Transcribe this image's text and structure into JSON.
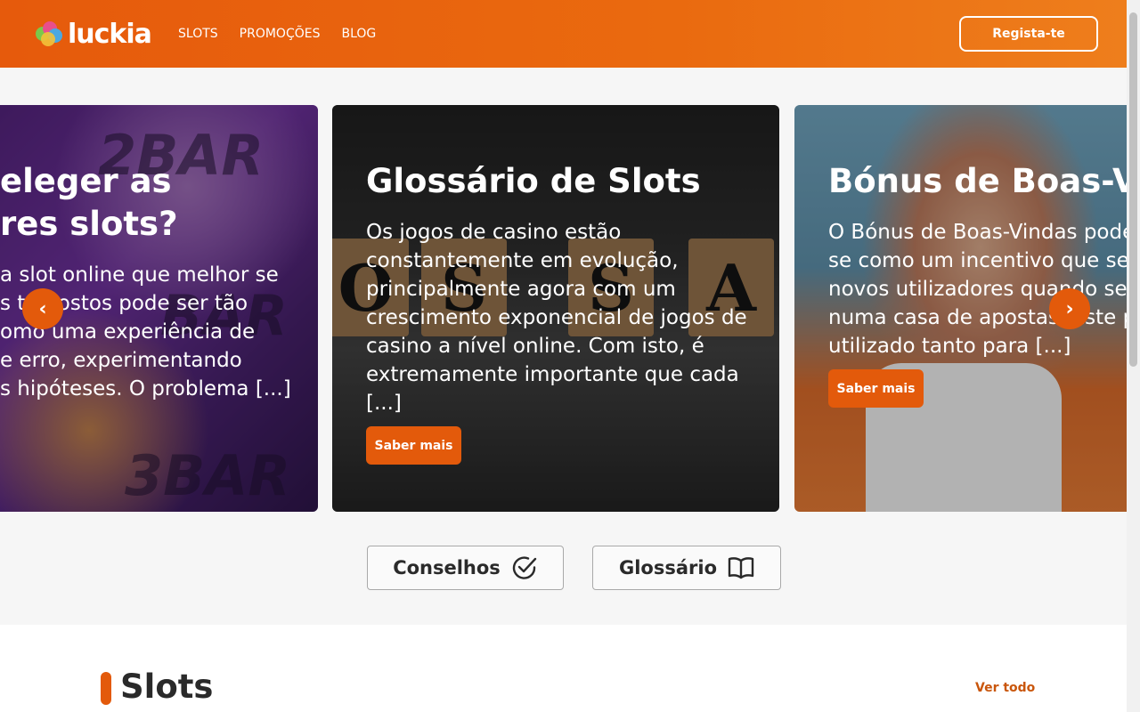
{
  "header": {
    "logo_text": "luckia",
    "nav": [
      "SLOTS",
      "PROMOÇÕES",
      "BLOG"
    ],
    "register_label": "Regista-te"
  },
  "carousel": {
    "cards": [
      {
        "title_lines": [
          "eleger as",
          "res slots?"
        ],
        "text": "a slot online que melhor se s t... gostos pode ser tão omo uma experiência de e erro, experimentando s hipóteses. O problema [...]",
        "text_lines": [
          "a slot online que melhor se",
          "s tu   gostos pode ser tão",
          "omo uma experiência de",
          "e erro, experimentando",
          "s hipóteses. O problema [...]"
        ],
        "image_words": [
          "2BAR",
          "BAR",
          "3BAR"
        ]
      },
      {
        "title_lines": [
          "Glossário de Slots"
        ],
        "text_lines": [
          "Os jogos de casino estão",
          "constantemente em evolução,",
          "principalmente agora com um",
          "crescimento exponencial de jogos de",
          "casino a nível online. Com isto, é",
          "extremamente importante que cada",
          "[...]"
        ],
        "button": "Saber mais",
        "image_letters": [
          "O",
          "S",
          "S",
          "A"
        ]
      },
      {
        "title_lines": [
          "Bónus de Boas-Vinc"
        ],
        "text_lines": [
          "O Bónus de Boas-Vindas pode",
          "se como um incentivo que se da",
          "novos utilizadores quando se re",
          "numa casa de apostas. Este po",
          "utilizado tanto para [...]"
        ],
        "button": "Saber mais"
      }
    ],
    "prev_icon": "chevron-left-icon",
    "next_icon": "chevron-right-icon"
  },
  "categories": [
    {
      "label": "Conselhos",
      "icon": "check-circle-icon"
    },
    {
      "label": "Glossário",
      "icon": "open-book-icon"
    }
  ],
  "slots_section": {
    "title": "Slots",
    "see_all": "Ver todo"
  },
  "colors": {
    "brand_orange": "#e35a0b",
    "header_gradient_start": "#e65a0c",
    "header_gradient_end": "#ee7e1c",
    "link_orange": "#c9560c"
  }
}
